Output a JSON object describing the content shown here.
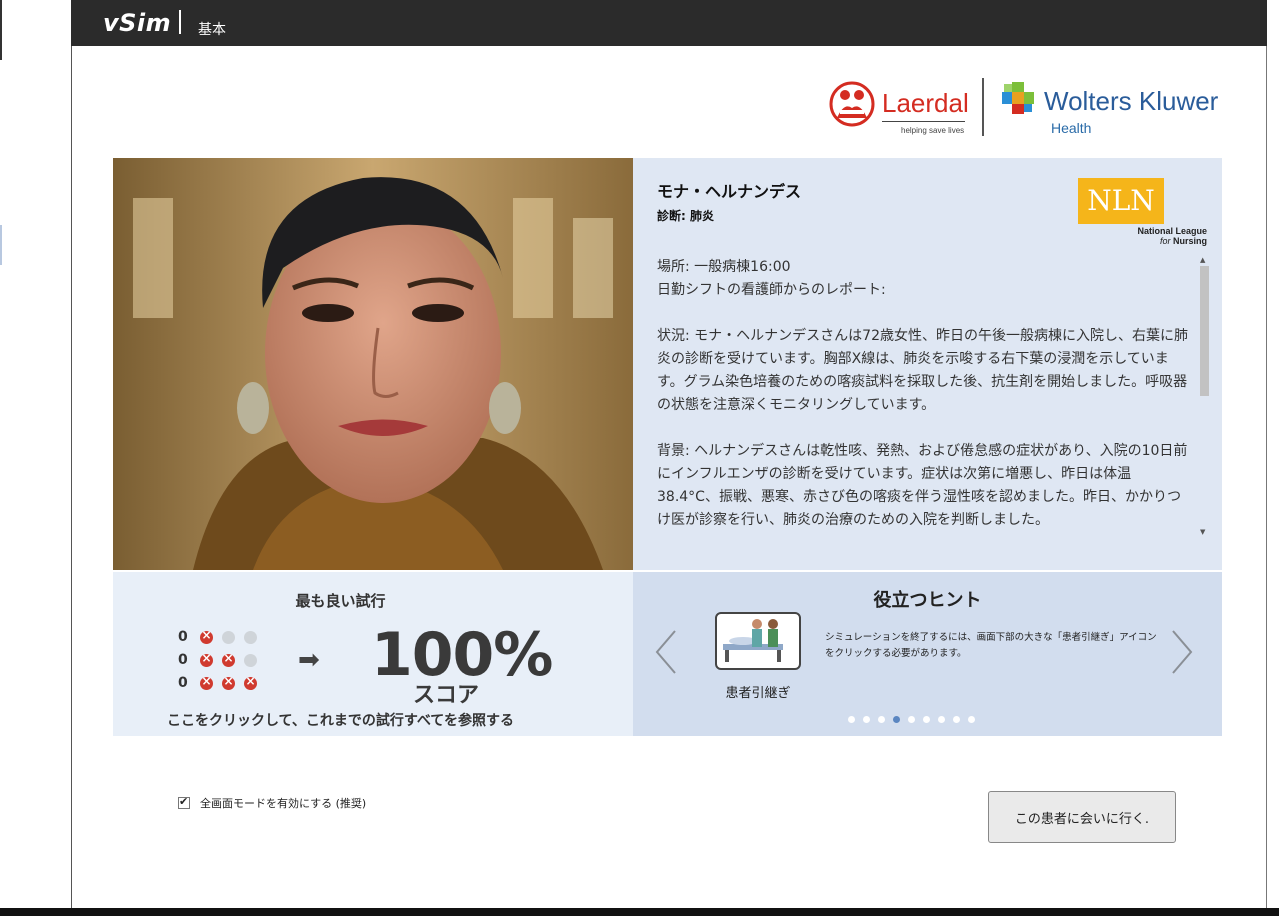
{
  "header": {
    "brand": "vSim",
    "subtitle": "基本"
  },
  "logos": {
    "laerdal_name": "Laerdal",
    "laerdal_tagline": "helping save lives",
    "wk_name": "Wolters Kluwer",
    "wk_health": "Health",
    "nln_mark": "NLN",
    "nln_line1": "National League",
    "nln_line2a": "for",
    "nln_line2b": "Nursing"
  },
  "patient": {
    "name": "モナ・ヘルナンデス",
    "diagnosis": "診断: 肺炎"
  },
  "report": {
    "location": "場所: 一般病棟16:00",
    "source": "日勤シフトの看護師からのレポート:",
    "situation": "状況: モナ・ヘルナンデスさんは72歳女性、昨日の午後一般病棟に入院し、右葉に肺炎の診断を受けています。胸部X線は、肺炎を示唆する右下葉の浸潤を示しています。グラム染色培養のための喀痰試料を採取した後、抗生剤を開始しました。呼吸器の状態を注意深くモニタリングしています。",
    "background": "背景: ヘルナンデスさんは乾性咳、発熱、および倦怠感の症状があり、入院の10日前にインフルエンザの診断を受けています。症状は次第に増悪し、昨日は体温38.4°C、振戦、悪寒、赤さび色の喀痰を伴う湿性咳を認めました。昨日、かかりつけ医が診察を行い、肺炎の治療のための入院を判断しました。"
  },
  "best_attempt": {
    "title": "最も良い試行",
    "rows": [
      {
        "count": "0",
        "marks": [
          "x",
          "empty",
          "empty"
        ]
      },
      {
        "count": "0",
        "marks": [
          "x",
          "x",
          "empty"
        ]
      },
      {
        "count": "0",
        "marks": [
          "x",
          "x",
          "x"
        ]
      }
    ],
    "score": "100%",
    "score_label": "スコア",
    "link": "ここをクリックして、これまでの試行すべてを参照する"
  },
  "hints": {
    "title": "役立つヒント",
    "icon_label": "患者引継ぎ",
    "text": "シミュレーションを終了するには、画面下部の大きな「患者引継ぎ」アイコンをクリックする必要があります。",
    "dots_total": 9,
    "active_dot_index": 3
  },
  "footer": {
    "fullscreen_label": "全画面モードを有効にする (推奨)",
    "fullscreen_checked": true,
    "go_button": "この患者に会いに行く."
  },
  "colors": {
    "header_bg": "#2b2b2b",
    "info_bg": "#dfe7f3",
    "hint_bg": "#d2ddee",
    "best_bg": "#e8eff8",
    "nln_gold": "#f5b51a",
    "laerdal_red": "#d42c21",
    "wk_blue": "#2a5c9a",
    "fail_red": "#d03a2f",
    "active_dot": "#5b86c1"
  }
}
